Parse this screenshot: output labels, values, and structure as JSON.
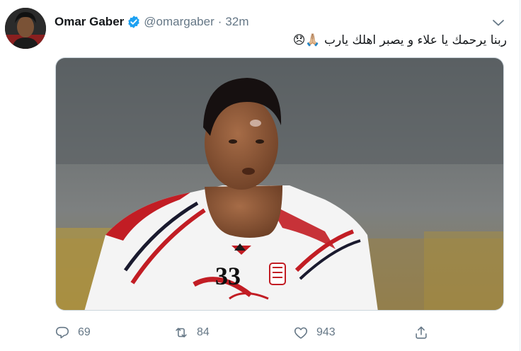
{
  "tweet": {
    "author_name": "Omar Gaber",
    "handle": "@omargaber",
    "separator": "·",
    "time": "32m",
    "text": "ربنا يرحمك يا علاء و يصبر اهلك يارب 🙏🏼😞",
    "media": {
      "jersey_number": "33"
    }
  },
  "actions": {
    "reply_count": "69",
    "retweet_count": "84",
    "like_count": "943"
  },
  "icons": {
    "verified": "verified-badge-icon",
    "caret": "chevron-down-icon",
    "reply": "reply-icon",
    "retweet": "retweet-icon",
    "like": "heart-icon",
    "share": "share-icon"
  },
  "colors": {
    "accent": "#1da1f2",
    "muted": "#657786",
    "text": "#14171a"
  }
}
